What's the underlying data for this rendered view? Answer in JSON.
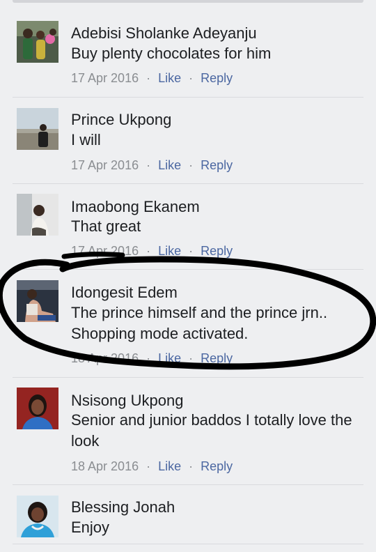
{
  "comments": [
    {
      "author": "Adebisi Sholanke Adeyanju",
      "text": "Buy plenty chocolates for him",
      "date": "17 Apr 2016",
      "like": "Like",
      "reply": "Reply"
    },
    {
      "author": "Prince Ukpong",
      "text": "I will",
      "date": "17 Apr 2016",
      "like": "Like",
      "reply": "Reply"
    },
    {
      "author": "Imaobong Ekanem",
      "text": "That great",
      "date": "17 Apr 2016",
      "like": "Like",
      "reply": "Reply"
    },
    {
      "author": "Idongesit Edem",
      "text": "The prince himself and the prince jrn.. Shopping mode activated.",
      "date": "18 Apr 2016",
      "like": "Like",
      "reply": "Reply"
    },
    {
      "author": "Nsisong Ukpong",
      "text": "Senior and junior baddos I totally love the look",
      "date": "18 Apr 2016",
      "like": "Like",
      "reply": "Reply"
    },
    {
      "author": "Blessing Jonah",
      "text": "Enjoy"
    }
  ],
  "separator": "·",
  "colors": {
    "background": "#eeeff1",
    "name_text": "#1c1e21",
    "meta_text": "#8a8d91",
    "action_link": "#4b67a1",
    "annotation_ink": "#000000"
  }
}
